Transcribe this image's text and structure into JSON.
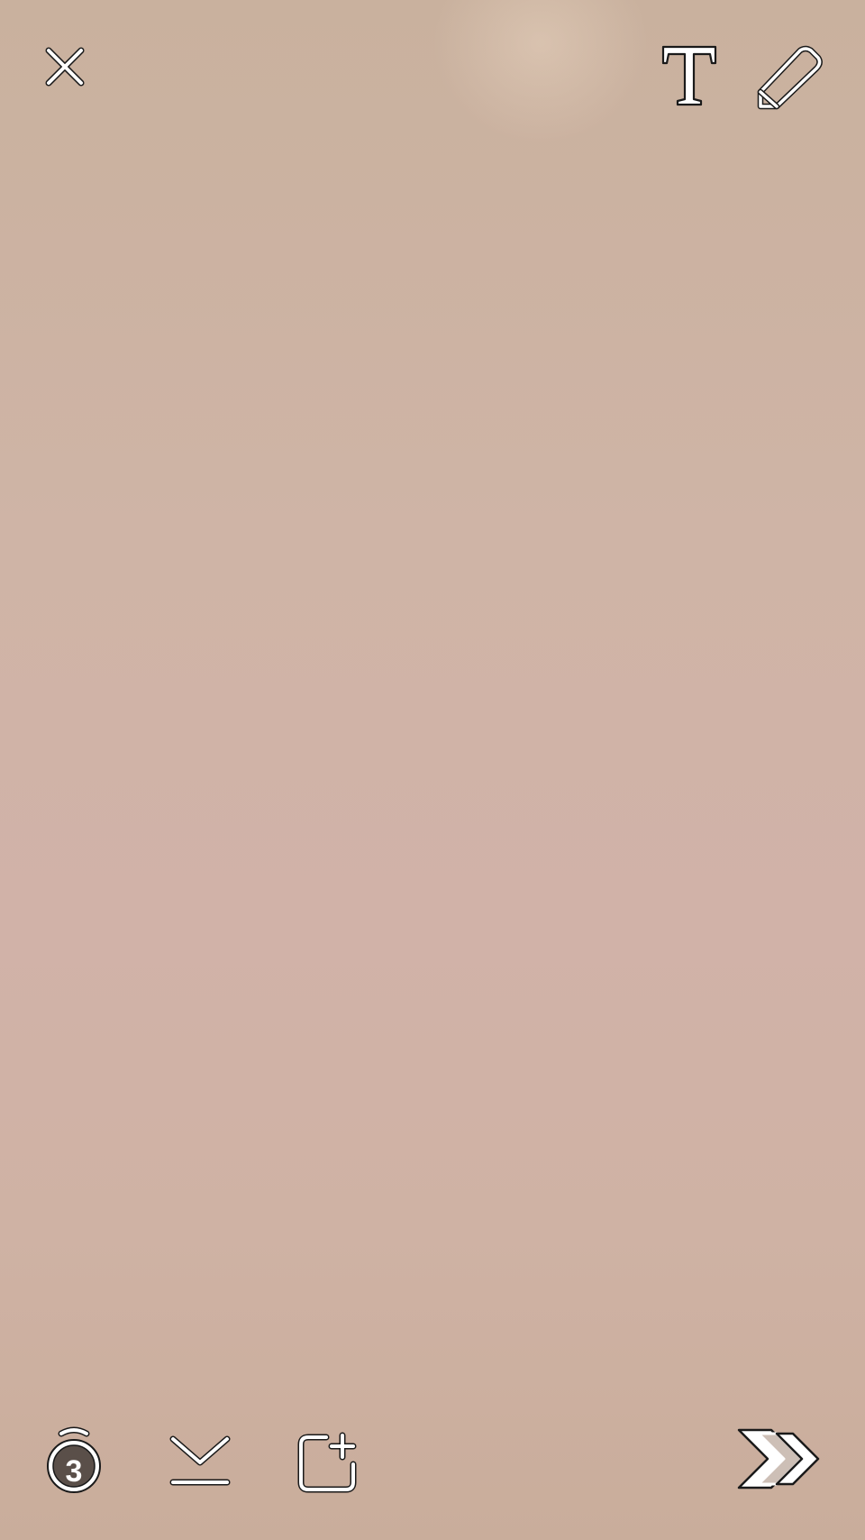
{
  "colors": {
    "icon_fill": "#ffffff",
    "icon_outline": "#1a1a1a",
    "timer_fill": "#5a4f49",
    "send_arrow_back": "#cdbfb6"
  },
  "toolbar_top": {
    "close": {
      "icon": "close-icon"
    },
    "text_tool": {
      "icon": "text-tool-icon"
    },
    "draw_tool": {
      "icon": "pencil-icon"
    }
  },
  "toolbar_bottom": {
    "timer": {
      "icon": "timer-icon",
      "value": "3"
    },
    "save": {
      "icon": "download-icon"
    },
    "add_story": {
      "icon": "add-to-story-icon"
    },
    "send": {
      "icon": "send-arrows-icon"
    }
  }
}
